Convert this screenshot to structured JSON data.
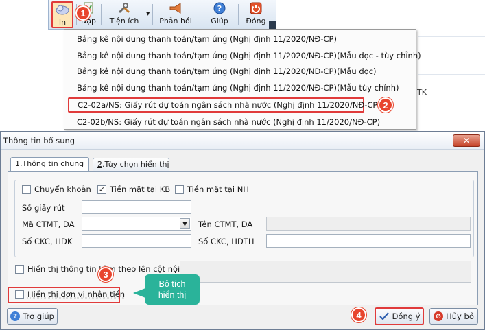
{
  "toolbar": {
    "items": [
      {
        "label": "In",
        "icon": "print-icon"
      },
      {
        "label": "Nạp",
        "icon": "import-icon"
      },
      {
        "label": "Tiện ích",
        "icon": "tools-icon"
      },
      {
        "label": "Phản hồi",
        "icon": "megaphone-icon"
      },
      {
        "label": "Giúp",
        "icon": "help-icon"
      },
      {
        "label": "Đóng",
        "icon": "power-icon"
      }
    ]
  },
  "menu": {
    "items": [
      "Bảng kê nội dung thanh toán/tạm ứng (Nghị định 11/2020/NĐ-CP)",
      "Bảng kê nội dung thanh toán/tạm ứng (Nghị định 11/2020/NĐ-CP)(Mẫu dọc - tùy chỉnh)",
      "Bảng kê nội dung thanh toán/tạm ứng (Nghị định 11/2020/NĐ-CP)(Mẫu dọc)",
      "Bảng kê nội dung thanh toán/tạm ứng (Nghị định 11/2020/NĐ-CP)(Mẫu tùy chỉnh)",
      "C2-02a/NS: Giấy rút dự toán ngân sách nhà nước (Nghị định 11/2020/NĐ-CP)",
      "C2-02b/NS: Giấy rút dự toán ngân sách nhà nước (Nghị định 11/2020/NĐ-CP)"
    ]
  },
  "background": {
    "partial_text": "TK"
  },
  "steps": [
    "1",
    "2",
    "3",
    "4"
  ],
  "dialog": {
    "title": "Thông tin bổ sung",
    "close_glyph": "✕",
    "tabs": [
      {
        "num": "1",
        "rest": ".Thông tin chung"
      },
      {
        "num": "2",
        "rest": ".Tùy chọn hiển thị"
      }
    ],
    "checkboxes": {
      "chuyen_khoan": {
        "label": "Chuyển khoản",
        "checked": false
      },
      "tien_mat_kb": {
        "label": "Tiền mặt tại KB",
        "checked": true
      },
      "tien_mat_nh": {
        "label": "Tiền mặt tại NH",
        "checked": false
      }
    },
    "fields": {
      "so_giay_rut": {
        "label": "Số giấy rút",
        "value": ""
      },
      "ma_ctmt": {
        "label": "Mã CTMT, DA",
        "value": ""
      },
      "ten_ctmt": {
        "label": "Tên CTMT, DA",
        "value": ""
      },
      "so_ckc_hdk": {
        "label": "Số CKC, HĐK",
        "value": ""
      },
      "so_ckc_hdth": {
        "label": "Số CKC, HĐTH",
        "value": ""
      }
    },
    "show_info_checkbox": {
      "label": "Hiển thị thông tin kèm theo lên cột nội dung",
      "checked": false
    },
    "show_unit_checkbox": {
      "label": "Hiển thị đơn vị nhận tiền",
      "checked": false
    },
    "callout": {
      "line1": "Bỏ tích",
      "line2": "hiển thị"
    },
    "buttons": {
      "help": "Trợ giúp",
      "ok": "Đồng ý",
      "cancel": "Hủy bỏ"
    }
  },
  "colors": {
    "highlight_red": "#e03b3b",
    "step_badge": "#e8452e",
    "callout_green": "#2ab39a",
    "toolbar_bg": "#d8e4f1"
  }
}
